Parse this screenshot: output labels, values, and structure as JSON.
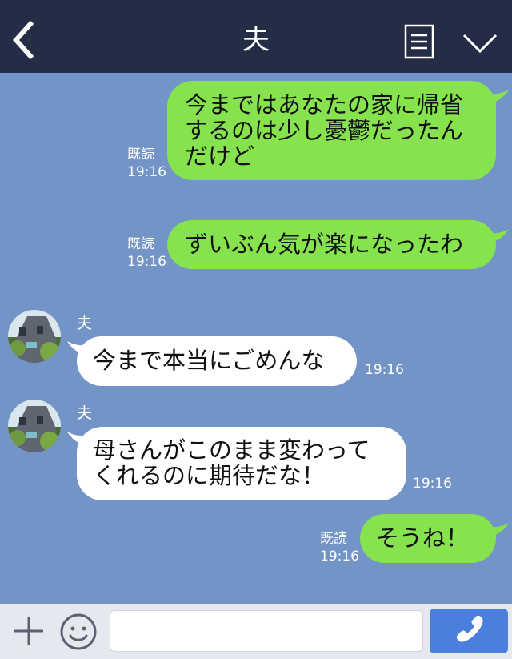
{
  "header": {
    "title": "夫",
    "back_icon": "chevron-left-icon",
    "menu_icon": "list-icon",
    "dropdown_icon": "chevron-down-icon"
  },
  "messages": [
    {
      "direction": "outgoing",
      "lines": [
        "今まではあなたの家に帰省",
        "するのは少し憂鬱だったん",
        "だけど"
      ],
      "read_label": "既読",
      "time": "19:16"
    },
    {
      "direction": "outgoing",
      "lines": [
        "ずいぶん気が楽になったわ"
      ],
      "read_label": "既読",
      "time": "19:16"
    },
    {
      "direction": "incoming",
      "sender": "夫",
      "lines": [
        "今まで本当にごめんな"
      ],
      "time": "19:16"
    },
    {
      "direction": "incoming",
      "sender": "夫",
      "lines": [
        "母さんがこのまま変わって",
        "くれるのに期待だな！"
      ],
      "time": "19:16"
    },
    {
      "direction": "outgoing",
      "lines": [
        "そうね！"
      ],
      "read_label": "既読",
      "time": "19:16"
    }
  ],
  "footer": {
    "plus_icon": "plus-icon",
    "emoji_icon": "smiley-icon",
    "input_value": "",
    "call_icon": "phone-icon"
  },
  "colors": {
    "header_bg": "#242c46",
    "chat_bg": "#7394c6",
    "outgoing_bubble": "#86e34e",
    "incoming_bubble": "#ffffff",
    "call_button": "#4a7fdc"
  }
}
